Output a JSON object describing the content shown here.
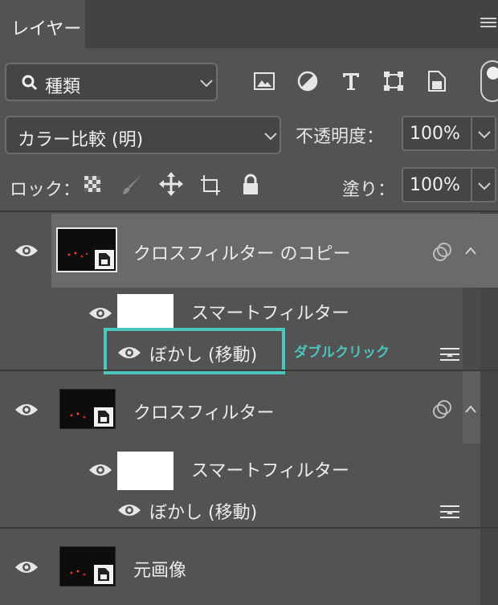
{
  "tab": {
    "label": "レイヤー"
  },
  "filter": {
    "label": "種類"
  },
  "blend_mode": {
    "label": "カラー比較 (明)"
  },
  "opacity": {
    "label": "不透明度：",
    "value": "100%"
  },
  "lock": {
    "label": "ロック："
  },
  "fill": {
    "label": "塗り：",
    "value": "100%"
  },
  "layers": [
    {
      "name": "クロスフィルター のコピー",
      "smart_filters_label": "スマートフィルター",
      "filter_name": "ぼかし (移動)"
    },
    {
      "name": "クロスフィルター",
      "smart_filters_label": "スマートフィルター",
      "filter_name": "ぼかし (移動)"
    },
    {
      "name": "元画像"
    }
  ],
  "annotation": {
    "text": "ダブルクリック",
    "color": "#4bc7bd"
  },
  "icons": [
    "search-icon",
    "image-filter-icon",
    "adjustment-filter-icon",
    "type-filter-icon",
    "shape-filter-icon",
    "smart-object-filter-icon",
    "lock-transparent-icon",
    "lock-paint-icon",
    "lock-move-icon",
    "lock-artboard-icon",
    "lock-all-icon",
    "eye-icon",
    "link-icon",
    "filter-options-icon",
    "panel-menu-icon"
  ]
}
